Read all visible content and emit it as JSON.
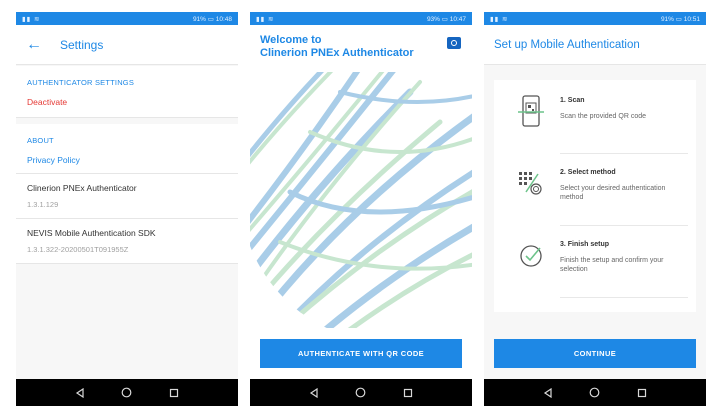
{
  "colors": {
    "accent": "#1e88e5",
    "danger": "#e53935",
    "status_bar": "#1e88e5",
    "nav_bar": "#000000"
  },
  "status_bars": [
    {
      "battery": "91%",
      "time": "10:48"
    },
    {
      "battery": "93%",
      "time": "10:47"
    },
    {
      "battery": "91%",
      "time": "10:51"
    }
  ],
  "settings_screen": {
    "title": "Settings",
    "back_icon": "arrow-left-icon",
    "sections": [
      {
        "header": "AUTHENTICATOR SETTINGS",
        "link": "Deactivate"
      },
      {
        "header": "ABOUT",
        "link": "Privacy Policy"
      }
    ],
    "info": [
      {
        "name": "Clinerion PNEx Authenticator",
        "version": "1.3.1.129"
      },
      {
        "name": "NEVIS Mobile Authentication SDK",
        "version": "1.3.1.322-20200501T091955Z"
      }
    ]
  },
  "welcome_screen": {
    "title_line1": "Welcome to",
    "title_line2": "Clinerion PNEx Authenticator",
    "camera_icon": "camera-icon",
    "button": "AUTHENTICATE WITH QR CODE"
  },
  "setup_screen": {
    "title": "Set up Mobile Authentication",
    "steps": [
      {
        "title": "1. Scan",
        "description": "Scan the provided QR code",
        "icon": "phone-qr-scan-icon"
      },
      {
        "title": "2. Select method",
        "description": "Select your desired authentication method",
        "icon": "keypad-fingerprint-icon"
      },
      {
        "title": "3. Finish setup",
        "description": "Finish the setup and confirm your selection",
        "icon": "check-circle-icon"
      }
    ],
    "button": "CONTINUE"
  },
  "nav_bar": {
    "back": "back-triangle-icon",
    "home": "home-circle-icon",
    "recents": "recents-square-icon"
  }
}
